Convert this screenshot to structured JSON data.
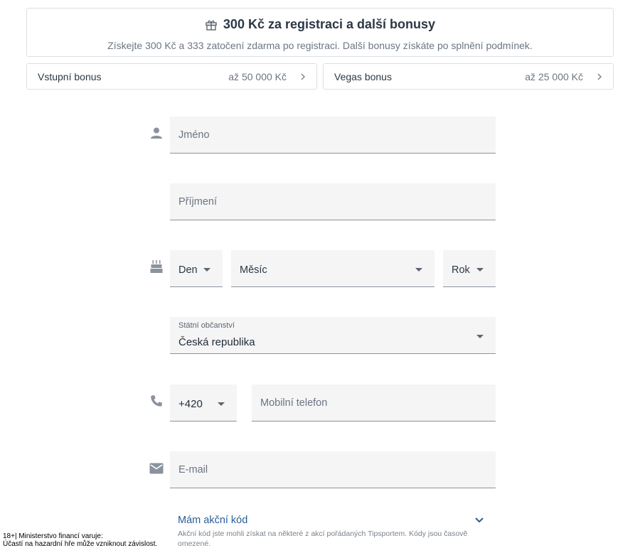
{
  "promo": {
    "icon": "gift-icon",
    "title": "300 Kč za registraci a další bonusy",
    "subtitle": "Získejte 300 Kč a 333 zatočení zdarma po registraci. Další bonusy získáte po splnění podmínek."
  },
  "bonuses": [
    {
      "label": "Vstupní bonus",
      "value": "až 50 000 Kč"
    },
    {
      "label": "Vegas bonus",
      "value": "až 25 000 Kč"
    }
  ],
  "form": {
    "first_name": {
      "placeholder": "Jméno",
      "icon": "person-icon"
    },
    "last_name": {
      "placeholder": "Příjmení"
    },
    "birth": {
      "icon": "cake-icon",
      "day": "Den",
      "month": "Měsíc",
      "year": "Rok"
    },
    "citizenship": {
      "label": "Státní občanství",
      "value": "Česká republika"
    },
    "phone": {
      "icon": "phone-icon",
      "prefix": "+420",
      "placeholder": "Mobilní telefon"
    },
    "email": {
      "icon": "mail-icon",
      "placeholder": "E-mail"
    }
  },
  "promo_code": {
    "title": "Mám akční kód",
    "description": "Akční kód jste mohli získat na některé z akcí pořádaných Tipsportem. Kódy jsou časově omezené.",
    "color": "#2a5d9a"
  },
  "legal": {
    "line1": "18+| Ministerstvo financí varuje:",
    "line2": "Účastí na hazardní hře může vzniknout závislost."
  }
}
